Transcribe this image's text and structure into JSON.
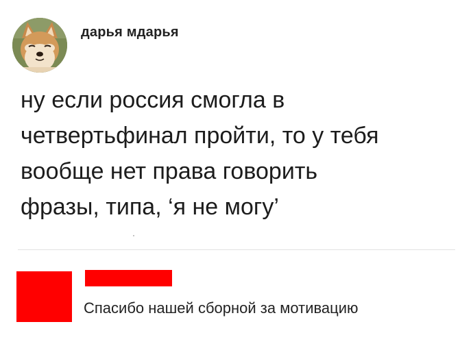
{
  "post": {
    "author": "дарья мдарья",
    "avatar_icon": "shiba-inu-dog-avatar",
    "text": "ну если россия смогла в\nчетвертьфинал пройти, то у тебя\nвообще нет права говорить\nфразы, типа, ‘я не могу’"
  },
  "comment": {
    "avatar_icon": "redacted-avatar",
    "author_redacted_color": "#ff0000",
    "text": "Спасибо нашей сборной за мотивацию"
  }
}
